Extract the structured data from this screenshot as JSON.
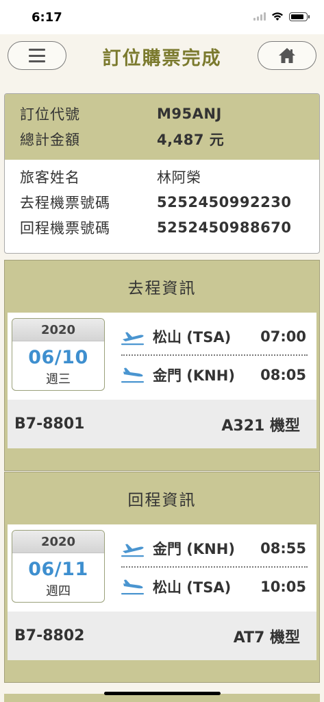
{
  "status": {
    "time": "6:17"
  },
  "header": {
    "title": "訂位購票完成",
    "menu_icon": "hamburger-icon",
    "home_icon": "home-icon"
  },
  "booking": {
    "code_label": "訂位代號",
    "code": "M95ANJ",
    "total_label": "總計金額",
    "total": "4,487 元",
    "name_label": "旅客姓名",
    "name": "林阿榮",
    "out_ticket_label": "去程機票號碼",
    "out_ticket": "5252450992230",
    "ret_ticket_label": "回程機票號碼",
    "ret_ticket": "5252450988670"
  },
  "outbound": {
    "title": "去程資訊",
    "year": "2020",
    "date": "06/10",
    "weekday": "週三",
    "dep_airport": "松山 (TSA)",
    "dep_time": "07:00",
    "arr_airport": "金門 (KNH)",
    "arr_time": "08:05",
    "flight_no": "B7-8801",
    "aircraft": "A321 機型"
  },
  "return": {
    "title": "回程資訊",
    "year": "2020",
    "date": "06/11",
    "weekday": "週四",
    "dep_airport": "金門 (KNH)",
    "dep_time": "08:55",
    "arr_airport": "松山 (TSA)",
    "arr_time": "10:05",
    "flight_no": "B7-8802",
    "aircraft": "AT7 機型"
  },
  "colors": {
    "accent_olive": "#c9c795",
    "title_olive": "#7b7a2e",
    "date_blue": "#3e8fcf",
    "plane_blue": "#4a95d0"
  }
}
